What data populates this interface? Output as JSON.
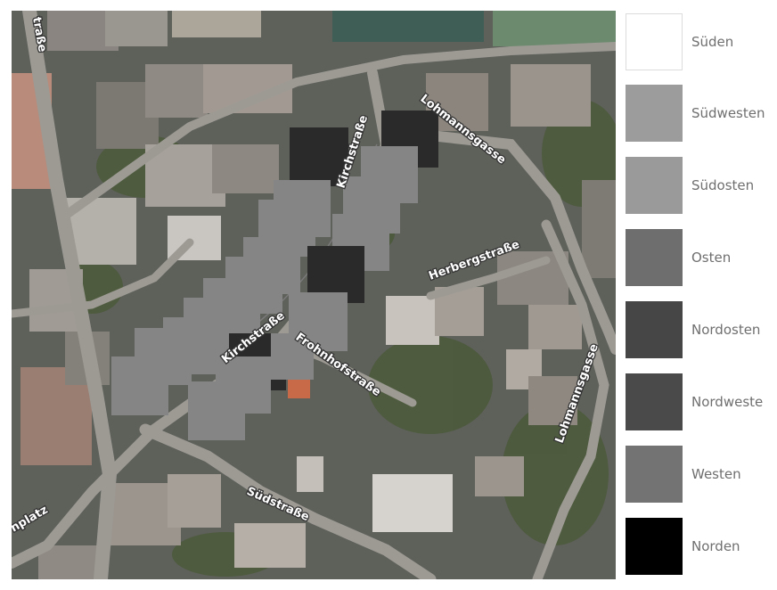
{
  "map": {
    "streets": [
      {
        "id": "kirchstrasse-north",
        "label": "Kirchstraße"
      },
      {
        "id": "lohmannsgasse-north",
        "label": "Lohmannsgasse"
      },
      {
        "id": "herbergstrasse",
        "label": "Herbergstraße"
      },
      {
        "id": "kirchstrasse-south",
        "label": "Kirchstraße"
      },
      {
        "id": "frohnhofstrasse",
        "label": "Frohnhofstraße"
      },
      {
        "id": "lohmannsgasse-east",
        "label": "Lohmannsgasse"
      },
      {
        "id": "suedstrasse",
        "label": "Südstraße"
      },
      {
        "id": "platz",
        "label": "nplatz"
      },
      {
        "id": "strasse-nw",
        "label": "traße"
      }
    ]
  },
  "legend": {
    "items": [
      {
        "label": "Süden",
        "color": "#ffffff"
      },
      {
        "label": "Südwesten",
        "color": "#9c9c9c"
      },
      {
        "label": "Südosten",
        "color": "#9a9a9a"
      },
      {
        "label": "Osten",
        "color": "#6e6e6e"
      },
      {
        "label": "Nordosten",
        "color": "#464646"
      },
      {
        "label": "Nordweste",
        "color": "#4a4a4a"
      },
      {
        "label": "Westen",
        "color": "#737373"
      },
      {
        "label": "Norden",
        "color": "#000000"
      }
    ]
  },
  "overlay_colors": {
    "light": "#858585",
    "dark": "#2a2a2a"
  }
}
